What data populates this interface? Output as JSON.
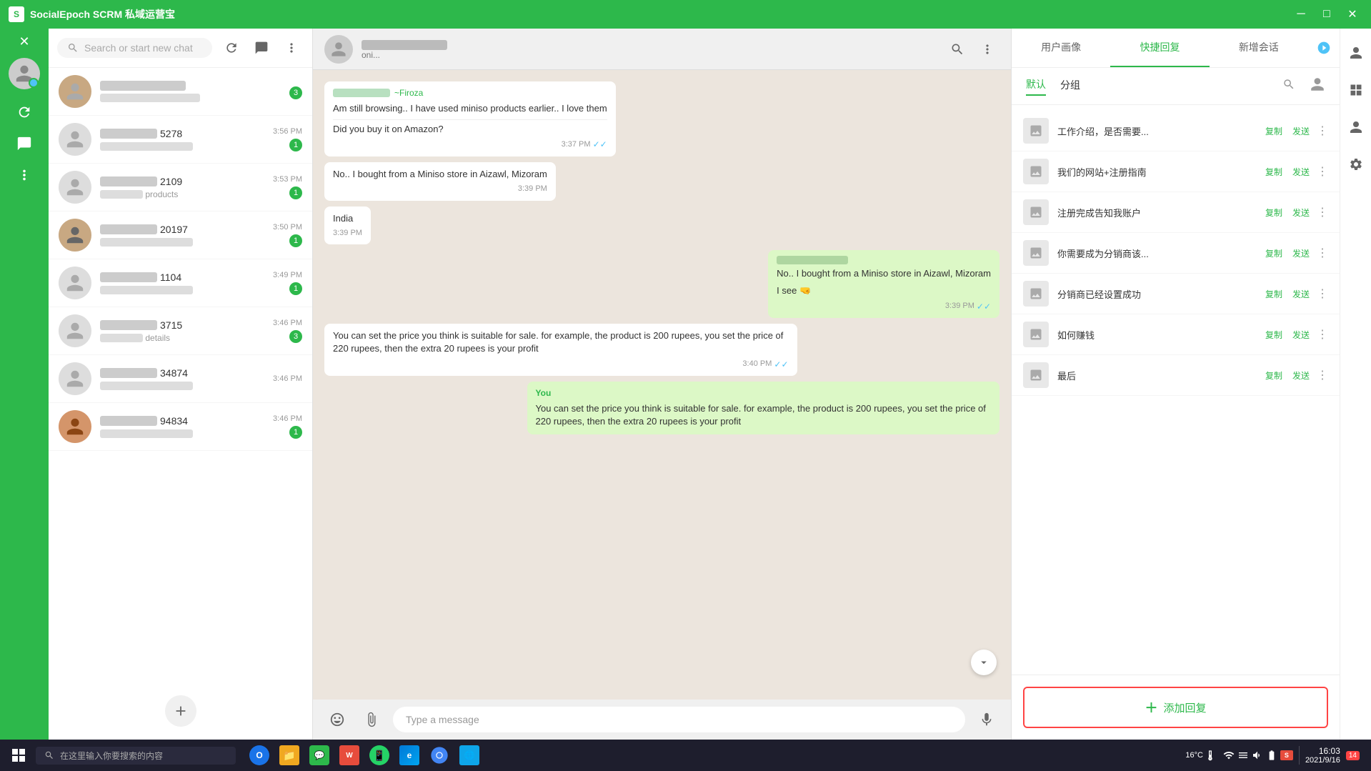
{
  "titleBar": {
    "title": "SocialEpoch SCRM 私域运营宝",
    "controls": [
      "minimize",
      "maximize",
      "close"
    ]
  },
  "chatListPanel": {
    "searchPlaceholder": "Search or start new chat",
    "chats": [
      {
        "id": 1,
        "nameBlurred": true,
        "nameWidth": 60,
        "time": "",
        "unread": 0,
        "previewBlurred": false,
        "hasImage": true,
        "imageColor": "#c8a882"
      },
      {
        "id": 2,
        "nameSuffix": "5278",
        "nameWidth": 80,
        "time": "3:56 PM",
        "unread": 1,
        "previewBlurred": true,
        "previewWidth": 100
      },
      {
        "id": 3,
        "nameSuffix": "2109",
        "nameWidth": 80,
        "time": "3:53 PM",
        "unread": 1,
        "previewText": "products",
        "previewBlurred": true,
        "previewWidth": 60
      },
      {
        "id": 4,
        "nameSuffix": "20197",
        "nameWidth": 80,
        "time": "3:50 PM",
        "unread": 1,
        "hasImage": true,
        "imageColor": "#e8d0a0"
      },
      {
        "id": 5,
        "nameSuffix": "1104",
        "nameWidth": 80,
        "time": "3:49 PM",
        "unread": 1,
        "previewBlurred": true,
        "previewWidth": 100
      },
      {
        "id": 6,
        "nameSuffix": "3715",
        "nameWidth": 80,
        "time": "3:46 PM",
        "unread": 3,
        "previewText": "details",
        "previewBlurred": true,
        "previewWidth": 60
      },
      {
        "id": 7,
        "nameSuffix": "34874",
        "nameWidth": 80,
        "time": "3:46 PM",
        "unread": 0,
        "previewBlurred": true,
        "previewWidth": 100
      },
      {
        "id": 8,
        "nameSuffix": "94834",
        "nameWidth": 80,
        "time": "3:46 PM",
        "unread": 1,
        "hasImage": true,
        "imageColor": "#d4956a"
      }
    ]
  },
  "chatPanel": {
    "contactNameBlurred": true,
    "statusText": "oni...",
    "messages": [
      {
        "type": "received",
        "senderBlurred": true,
        "senderSuffix": "~Firoza",
        "text": "Am still browsing.. I have used miniso products earlier.. I love them",
        "subText": "Did you buy it on Amazon?",
        "time": "3:37 PM",
        "hasCheck": true
      },
      {
        "type": "received",
        "text": "No.. I bought from a Miniso store in Aizawl, Mizoram",
        "time": "3:39 PM",
        "hasCheck": false
      },
      {
        "type": "received",
        "text": "India",
        "time": "3:39 PM",
        "hasCheck": false
      },
      {
        "type": "sent",
        "senderBlurred": true,
        "text": "No.. I bought from a Miniso store in Aizawl, Mizoram",
        "subText": "I see 🤜",
        "time": "3:39 PM",
        "hasCheck": true
      },
      {
        "type": "received",
        "text": "You can set the price you think is suitable for sale. for example, the product is 200 rupees, you set the price of 220 rupees, then the extra 20 rupees is your profit",
        "time": "3:40 PM",
        "hasCheck": true
      },
      {
        "type": "sent_quote",
        "sender": "You",
        "quotedText": "You can set the price you think is suitable for sale. for example, the product is 200 rupees, you set the price of 220 rupees, then the extra 20 rupees is your profit",
        "time": ""
      }
    ],
    "inputPlaceholder": "Type a message"
  },
  "rightPanel": {
    "tabs": [
      "用户画像",
      "快捷回复",
      "新增会话"
    ],
    "subTabs": [
      "默认",
      "分组"
    ],
    "activeTab": "快捷回复",
    "activeSubTab": "默认",
    "quickReplies": [
      {
        "id": 1,
        "text": "工作介绍，是否需要..."
      },
      {
        "id": 2,
        "text": "我们的网站+注册指南"
      },
      {
        "id": 3,
        "text": "注册完成告知我账户"
      },
      {
        "id": 4,
        "text": "你需要成为分销商该..."
      },
      {
        "id": 5,
        "text": "分销商已经设置成功"
      },
      {
        "id": 6,
        "text": "如何赚钱"
      },
      {
        "id": 7,
        "text": "最后"
      }
    ],
    "copyLabel": "复制",
    "sendLabel": "发送",
    "addReplyLabel": "添加回复"
  },
  "taskbar": {
    "searchText": "在这里输入你要搜索的内容",
    "clock": {
      "time": "16:03",
      "date": "2021/9/16"
    },
    "notifCount": "14",
    "temperature": "16°C"
  }
}
